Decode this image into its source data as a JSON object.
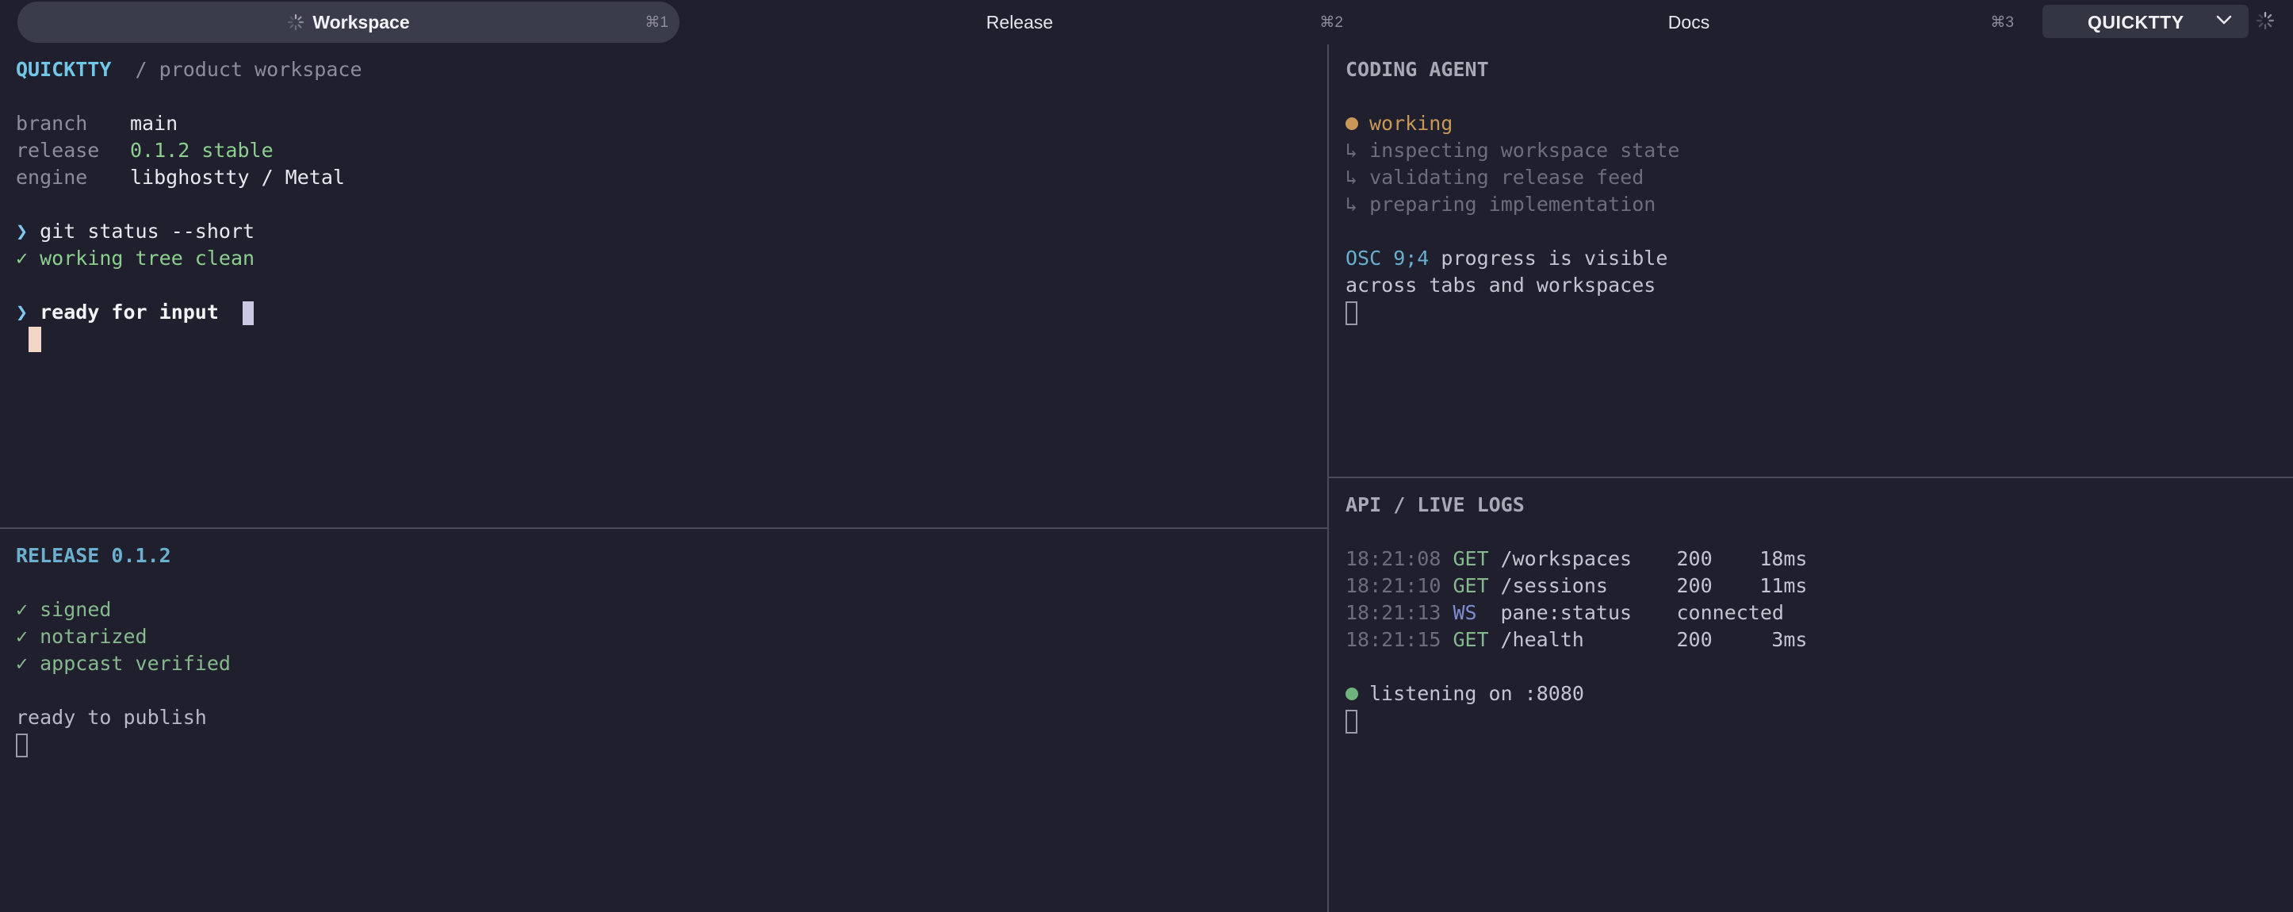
{
  "tabs": [
    {
      "label": "Workspace",
      "shortcut": "⌘1",
      "active": true,
      "loading": true
    },
    {
      "label": "Release",
      "shortcut": "⌘2",
      "active": false
    },
    {
      "label": "Docs",
      "shortcut": "⌘3",
      "active": false
    }
  ],
  "workspace_switcher": {
    "label": "QUICKTTY"
  },
  "panes": {
    "main": {
      "brand": "QUICKTTY",
      "subtitle": "/ product workspace",
      "info": [
        {
          "key": "branch",
          "value": "main"
        },
        {
          "key": "release",
          "value": "0.1.2 stable"
        },
        {
          "key": "engine",
          "value": "libghostty / Metal"
        }
      ],
      "prompt_symbol": "❯",
      "command": "git status --short",
      "check_symbol": "✓",
      "result": "working tree clean",
      "ready_text": "ready for input"
    },
    "release": {
      "title": "RELEASE 0.1.2",
      "checks": [
        "signed",
        "notarized",
        "appcast verified"
      ],
      "check_symbol": "✓",
      "status": "ready to publish"
    },
    "agent": {
      "title": "CODING AGENT",
      "state": "working",
      "branch_symbol": "↳",
      "steps": [
        "inspecting workspace state",
        "validating release feed",
        "preparing implementation"
      ],
      "osc_code": "OSC 9;4",
      "osc_text": "progress is visible",
      "osc_text2": "across tabs and workspaces"
    },
    "logs": {
      "title": "API / LIVE LOGS",
      "entries": [
        {
          "time": "18:21:08",
          "method": "GET",
          "path": "/workspaces",
          "status": "200",
          "latency": "18ms"
        },
        {
          "time": "18:21:10",
          "method": "GET",
          "path": "/sessions",
          "status": "200",
          "latency": "11ms"
        },
        {
          "time": "18:21:13",
          "method": "WS",
          "path": "pane:status",
          "status": "connected",
          "latency": ""
        },
        {
          "time": "18:21:15",
          "method": "GET",
          "path": "/health",
          "status": "200",
          "latency": "3ms"
        }
      ],
      "listening": "listening on :8080"
    }
  },
  "colors": {
    "background": "#1f1f2d",
    "accent_cyan": "#73c7e6",
    "success_green": "#8ccf8f",
    "working_orange": "#c99858",
    "listening_green": "#6fb47a"
  }
}
